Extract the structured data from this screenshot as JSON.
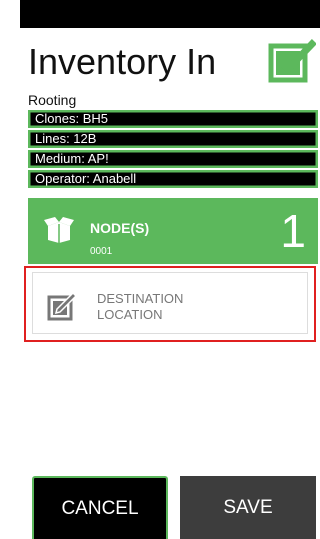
{
  "header": {
    "title": "Inventory In",
    "subtitle": "Rooting",
    "icon": "edit-check-icon"
  },
  "info": [
    {
      "text": "Clones: BH5"
    },
    {
      "text": "Lines: 12B"
    },
    {
      "text": "Medium: AP!"
    },
    {
      "text": "Operator: Anabell"
    }
  ],
  "node_card": {
    "label": "NODE(S)",
    "sub": "0001",
    "count": "1",
    "icon": "box-open-icon"
  },
  "destination": {
    "label": "DESTINATION\nLOCATION",
    "icon": "edit-icon"
  },
  "buttons": {
    "cancel": "CANCEL",
    "save": "SAVE"
  },
  "colors": {
    "accent_green": "#5cb85c",
    "highlight_red": "#e02020",
    "dark": "#000000",
    "save_bg": "#3d3d3d"
  }
}
